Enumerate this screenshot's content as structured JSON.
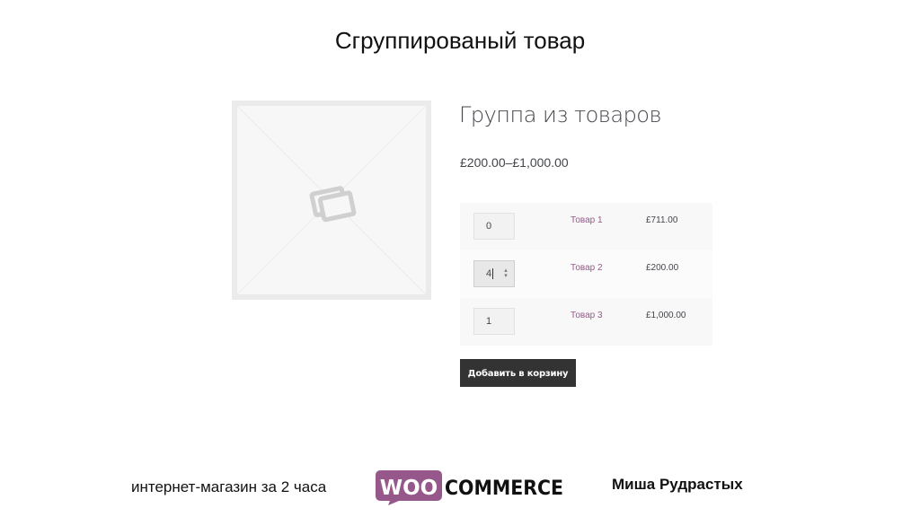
{
  "slide": {
    "title": "Сгруппированый товар",
    "footer_left": "интернет-магазин за 2 часа",
    "footer_right": "Миша Рудрастых",
    "logo": {
      "left": "WOO",
      "right": "COMMERCE"
    }
  },
  "product": {
    "image_icon": "placeholder-image-icon",
    "title": "Группа из товаров",
    "price_range": "£200.00–£1,000.00",
    "items": [
      {
        "qty": "0",
        "name": "Товар 1",
        "price": "£711.00"
      },
      {
        "qty": "4",
        "name": "Товар 2",
        "price": "£200.00"
      },
      {
        "qty": "1",
        "name": "Товар 3",
        "price": "£1,000.00"
      }
    ],
    "add_to_cart_label": "Добавить в корзину"
  },
  "colors": {
    "link": "#96588a",
    "button": "#333333",
    "woo_purple": "#96588a"
  }
}
